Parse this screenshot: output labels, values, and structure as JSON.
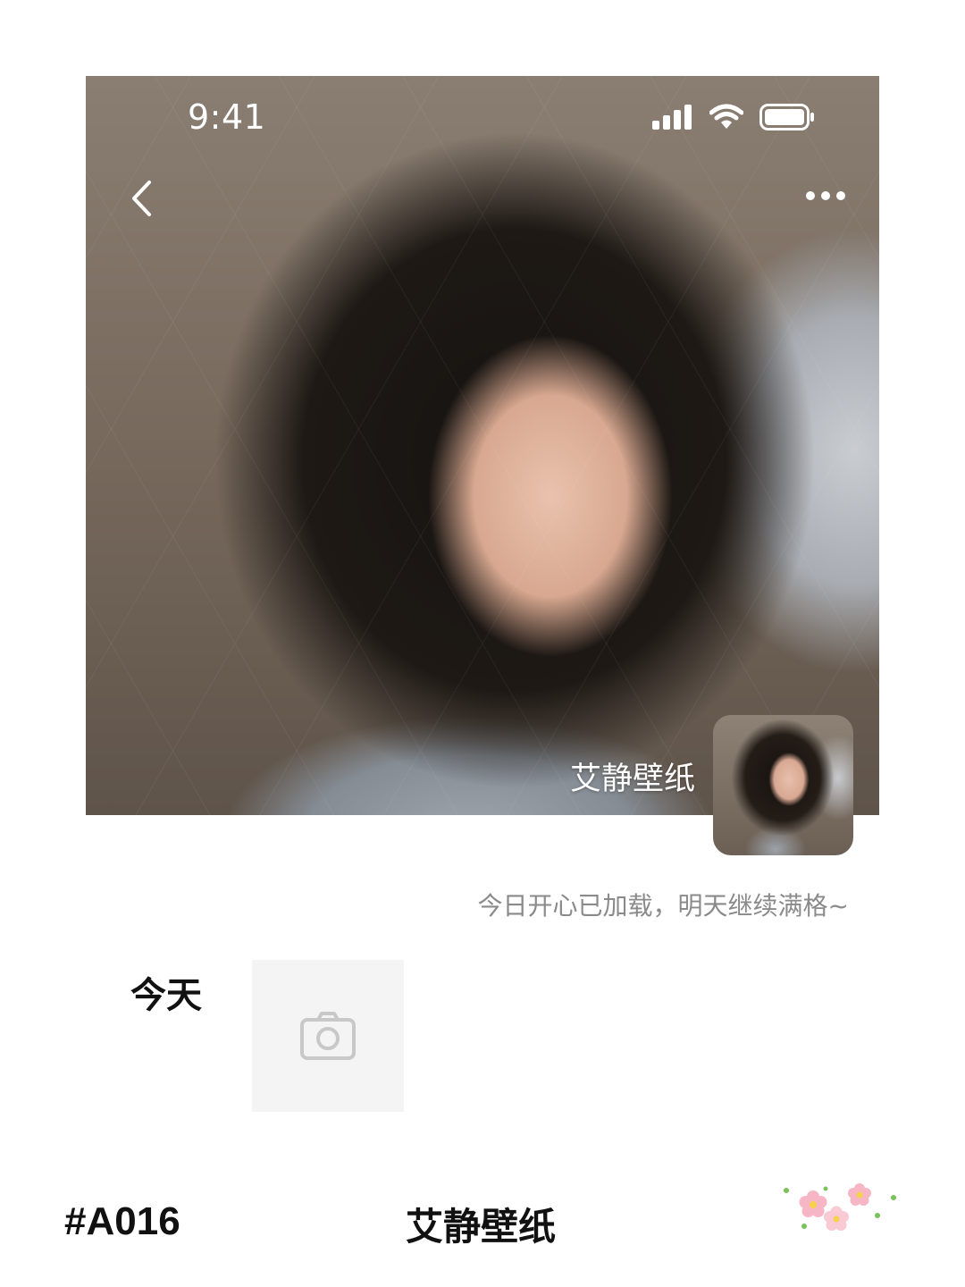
{
  "status_bar": {
    "time": "9:41"
  },
  "header": {
    "back_icon": "chevron-left-icon",
    "more_icon": "more-horizontal-icon",
    "album_name": "艾静壁纸"
  },
  "message": {
    "text": "今日开心已加载，明天继续满格~"
  },
  "today_section": {
    "label": "今天",
    "upload_icon": "camera-icon"
  },
  "footer": {
    "code": "#A016",
    "brand": "艾静壁纸",
    "decoration_icon": "flowers-icon"
  },
  "colors": {
    "background": "#ffffff",
    "text_primary": "#111111",
    "text_secondary": "#8a8a8a",
    "upload_bg": "#f4f4f4",
    "icon_gray": "#c8c8c8"
  }
}
